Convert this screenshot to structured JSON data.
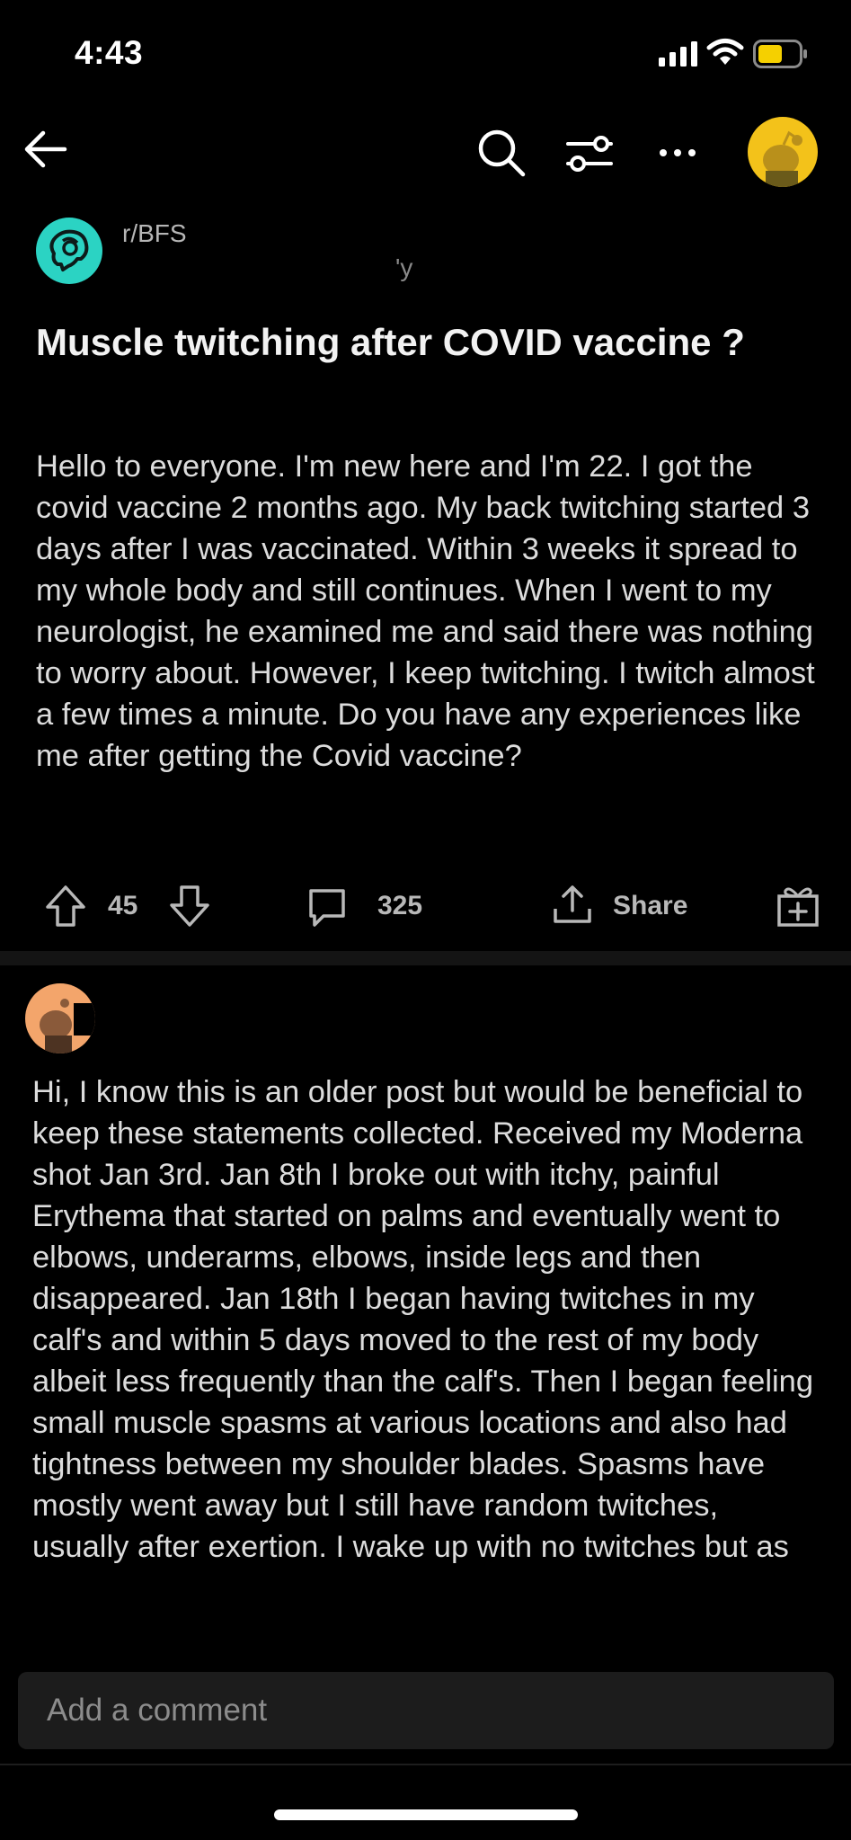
{
  "status_bar": {
    "time": "4:43"
  },
  "nav": {
    "icons": [
      "back-arrow-icon",
      "search-icon",
      "filter-icon",
      "more-icon",
      "user-avatar"
    ]
  },
  "post": {
    "subreddit": "r/BFS",
    "meta": "'y",
    "title": "Muscle twitching after COVID vaccine ?",
    "body": "Hello to everyone. I'm new here and I'm 22. I got the covid vaccine 2 months ago. My back twitching started 3 days after I was vaccinated. Within 3 weeks it spread to my whole body and still continues. When I went to my neurologist, he examined me and said there was nothing to worry about. However, I keep twitching. I twitch almost a few times a minute. Do you have any experiences like me after getting the Covid vaccine?",
    "votes": "45",
    "comments": "325",
    "share_label": "Share"
  },
  "comment": {
    "author_marker": "-",
    "body": "Hi, I know this is an older post but would be beneficial to keep these statements collected. Received my Moderna shot Jan 3rd. Jan 8th I broke out with itchy, painful Erythema that started on palms and eventually went to elbows, underarms, elbows, inside legs and then disappeared. Jan 18th I began having twitches in my calf's and within 5 days moved to the rest of my body albeit less frequently than the calf's. Then I began feeling small muscle spasms at various locations and also had tightness between my shoulder blades. Spasms have mostly went away but I still have random twitches, usually after exertion. I wake up with no twitches but as"
  },
  "comment_input": {
    "placeholder": "Add a comment"
  },
  "colors": {
    "background": "#000000",
    "subreddit_icon": "#2bd3c3",
    "user_avatar": "#f3c21a",
    "comment_avatar": "#f3a56b",
    "battery": "#f5d000"
  }
}
